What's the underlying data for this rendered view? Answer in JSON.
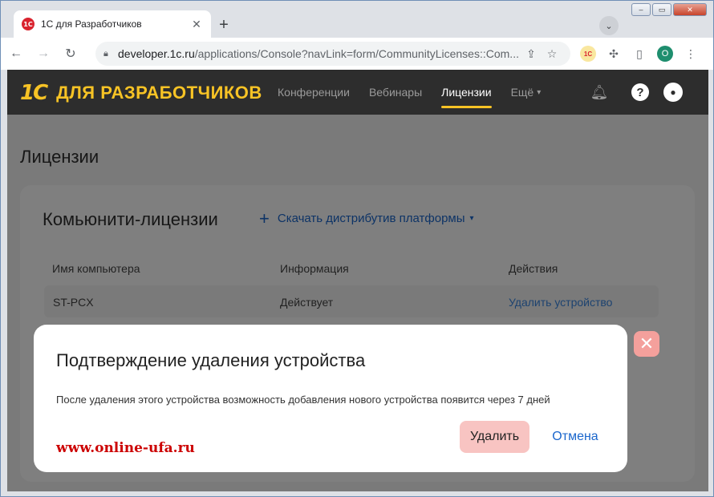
{
  "browser": {
    "tab_title": "1С для Разработчиков",
    "tab_favicon": "1С",
    "tab_close": "✕",
    "new_tab": "+",
    "url_host": "developer.1c.ru",
    "url_path": "/applications/Console?navLink=form/CommunityLicenses::Com...",
    "profile_initial": "O",
    "ext_1c": "1С"
  },
  "site": {
    "logo_mark": "1С",
    "logo_text": "ДЛЯ РАЗРАБОТЧИКОВ",
    "nav": [
      {
        "label": "Конференции"
      },
      {
        "label": "Вебинары"
      },
      {
        "label": "Лицензии"
      },
      {
        "label": "Ещё"
      }
    ]
  },
  "page": {
    "title": "Лицензии",
    "card_title": "Комьюнити-лицензии",
    "download_link": "Скачать дистрибутив платформы",
    "table": {
      "headers": [
        "Имя компьютера",
        "Информация",
        "Действия"
      ],
      "rows": [
        [
          "ST-PCX",
          "Действует",
          "Удалить устройство"
        ]
      ]
    }
  },
  "dialog": {
    "title": "Подтверждение удаления устройства",
    "text": "После удаления этого устройства возможность добавления нового устройства появится через 7 дней",
    "delete_label": "Удалить",
    "cancel_label": "Отмена",
    "watermark": "www.online-ufa.ru"
  },
  "colors": {
    "accent_yellow": "#f7c325",
    "link_blue": "#1a66cc",
    "delete_bg": "#f8c4c2"
  }
}
